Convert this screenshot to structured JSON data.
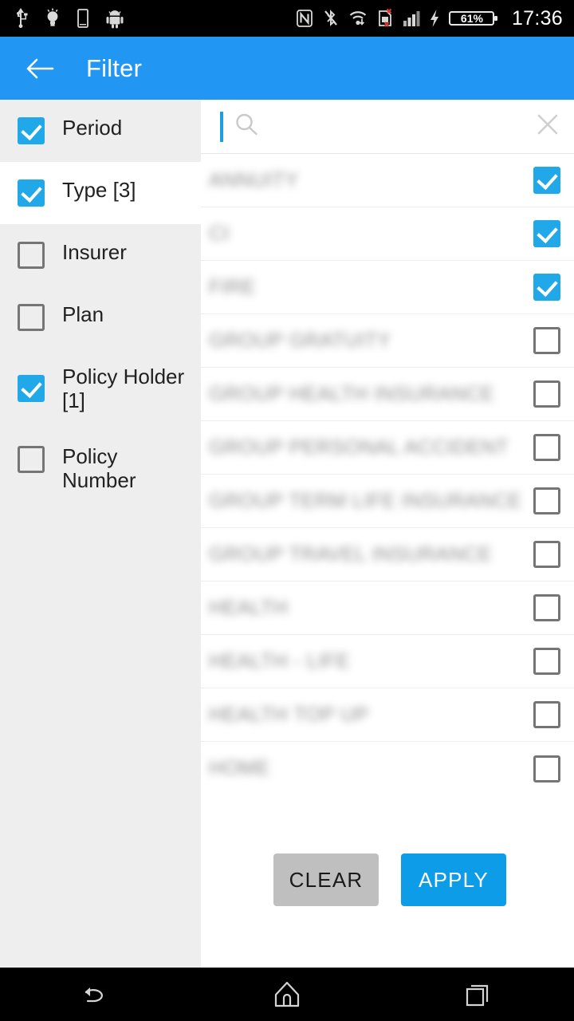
{
  "status_bar": {
    "time": "17:36",
    "battery_percent": "61%",
    "left_icons": [
      "usb-icon",
      "flashlight-icon",
      "device-icon",
      "android-robot-icon"
    ],
    "right_icons": [
      "nfc-icon",
      "bluetooth-off-icon",
      "wifi-icon",
      "sim-card-error-icon",
      "signal-bars-icon",
      "charging-bolt-icon",
      "battery-icon"
    ]
  },
  "app_bar": {
    "back_label": "back-arrow",
    "title": "Filter"
  },
  "colors": {
    "accent": "#2196f3",
    "checkbox_checked": "#20a8e8",
    "apply_button": "#0d9ce8",
    "clear_button": "#bfbfbf",
    "sidebar_bg": "#eeeeee"
  },
  "sidebar": {
    "items": [
      {
        "label": "Period",
        "checked": true,
        "highlighted": true
      },
      {
        "label": "Type [3]",
        "checked": true,
        "highlighted": false
      },
      {
        "label": "Insurer",
        "checked": false,
        "highlighted": true
      },
      {
        "label": "Plan",
        "checked": false,
        "highlighted": true
      },
      {
        "label": "Policy Holder [1]",
        "checked": true,
        "highlighted": true
      },
      {
        "label": "Policy Number",
        "checked": false,
        "highlighted": true
      }
    ]
  },
  "search": {
    "value": "",
    "placeholder": "",
    "icon": "search-icon",
    "clear_icon": "close-icon"
  },
  "options": {
    "items": [
      {
        "label": "ANNUITY",
        "checked": true
      },
      {
        "label": "CI",
        "checked": true
      },
      {
        "label": "FIRE",
        "checked": true
      },
      {
        "label": "GROUP GRATUITY",
        "checked": false
      },
      {
        "label": "GROUP HEALTH INSURANCE",
        "checked": false
      },
      {
        "label": "GROUP PERSONAL ACCIDENT",
        "checked": false
      },
      {
        "label": "GROUP TERM LIFE INSURANCE",
        "checked": false
      },
      {
        "label": "GROUP TRAVEL INSURANCE",
        "checked": false
      },
      {
        "label": "HEALTH",
        "checked": false
      },
      {
        "label": "HEALTH - LIFE",
        "checked": false
      },
      {
        "label": "HEALTH TOP UP",
        "checked": false
      },
      {
        "label": "HOME",
        "checked": false
      }
    ]
  },
  "actions": {
    "clear_label": "CLEAR",
    "apply_label": "APPLY"
  },
  "nav_bar": {
    "back": "back-nav-icon",
    "home": "home-nav-icon",
    "recents": "recents-nav-icon"
  }
}
